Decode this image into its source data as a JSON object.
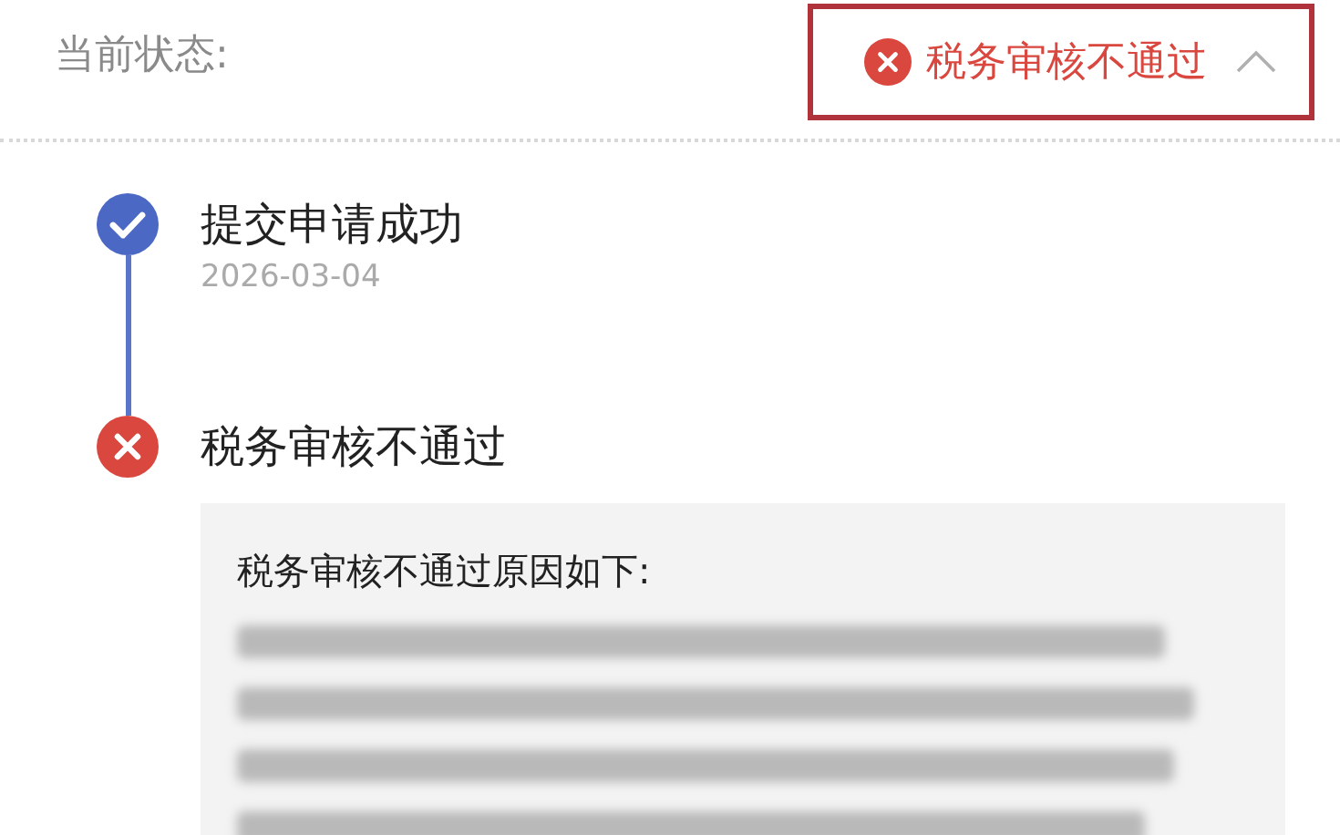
{
  "status": {
    "label": "当前状态:",
    "value": "税务审核不通过",
    "kind": "failed",
    "highlighted": true,
    "expanded": true
  },
  "timeline": [
    {
      "kind": "done",
      "title": "提交申请成功",
      "date": "2026-03-04"
    },
    {
      "kind": "failed",
      "title": "税务审核不通过",
      "reason_title": "税务审核不通过原因如下:"
    }
  ]
}
